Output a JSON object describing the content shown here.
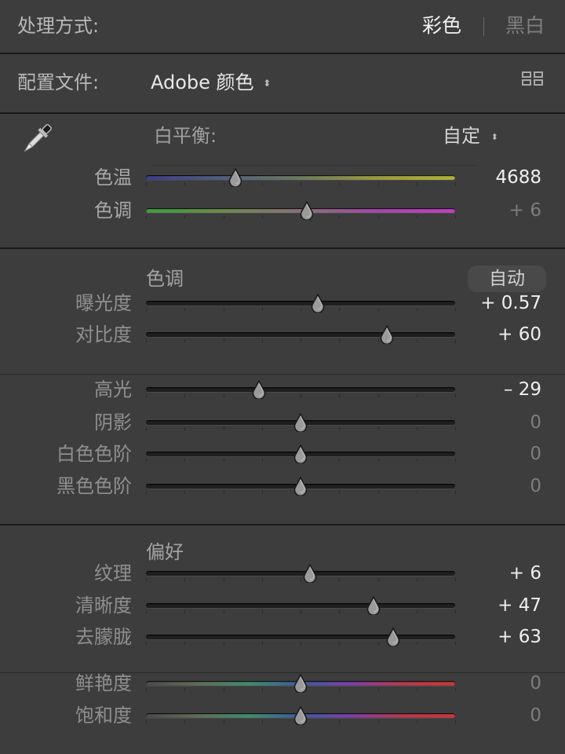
{
  "treatment": {
    "label": "处理方式:",
    "color": "彩色",
    "bw": "黑白"
  },
  "profile": {
    "label": "配置文件:",
    "value": "Adobe 颜色",
    "arrows": "⬍"
  },
  "white_balance": {
    "label": "白平衡:",
    "value": "自定",
    "arrows": "⬍"
  },
  "sections": {
    "tone_title": "色调",
    "auto": "自动",
    "presence_title": "偏好"
  },
  "sliders": [
    {
      "key": "temp",
      "label": "色温",
      "value": "4688",
      "pos": 0.29,
      "track": "temp"
    },
    {
      "key": "tint",
      "label": "色调",
      "value": "+ 6",
      "pos": 0.52,
      "track": "tint"
    },
    {
      "key": "exposure",
      "label": "曝光度",
      "value": "+ 0.57",
      "pos": 0.555,
      "track": "gray"
    },
    {
      "key": "contrast",
      "label": "对比度",
      "value": "+ 60",
      "pos": 0.78,
      "track": "gray"
    },
    {
      "key": "highlights",
      "label": "高光",
      "value": "– 29",
      "pos": 0.365,
      "track": "gray"
    },
    {
      "key": "shadows",
      "label": "阴影",
      "value": "0",
      "pos": 0.5,
      "track": "gray"
    },
    {
      "key": "whites",
      "label": "白色色阶",
      "value": "0",
      "pos": 0.5,
      "track": "gray"
    },
    {
      "key": "blacks",
      "label": "黑色色阶",
      "value": "0",
      "pos": 0.5,
      "track": "gray"
    },
    {
      "key": "texture",
      "label": "纹理",
      "value": "+ 6",
      "pos": 0.53,
      "track": "gray"
    },
    {
      "key": "clarity",
      "label": "清晰度",
      "value": "+ 47",
      "pos": 0.735,
      "track": "gray"
    },
    {
      "key": "dehaze",
      "label": "去朦胧",
      "value": "+ 63",
      "pos": 0.8,
      "track": "gray"
    },
    {
      "key": "vibrance",
      "label": "鲜艳度",
      "value": "0",
      "pos": 0.5,
      "track": "sat"
    },
    {
      "key": "saturation",
      "label": "饱和度",
      "value": "0",
      "pos": 0.5,
      "track": "sat"
    }
  ],
  "colors": {
    "panel_bg": "#3d3d3d",
    "active_text": "#efefef",
    "dim_text": "#7d7d7d"
  }
}
